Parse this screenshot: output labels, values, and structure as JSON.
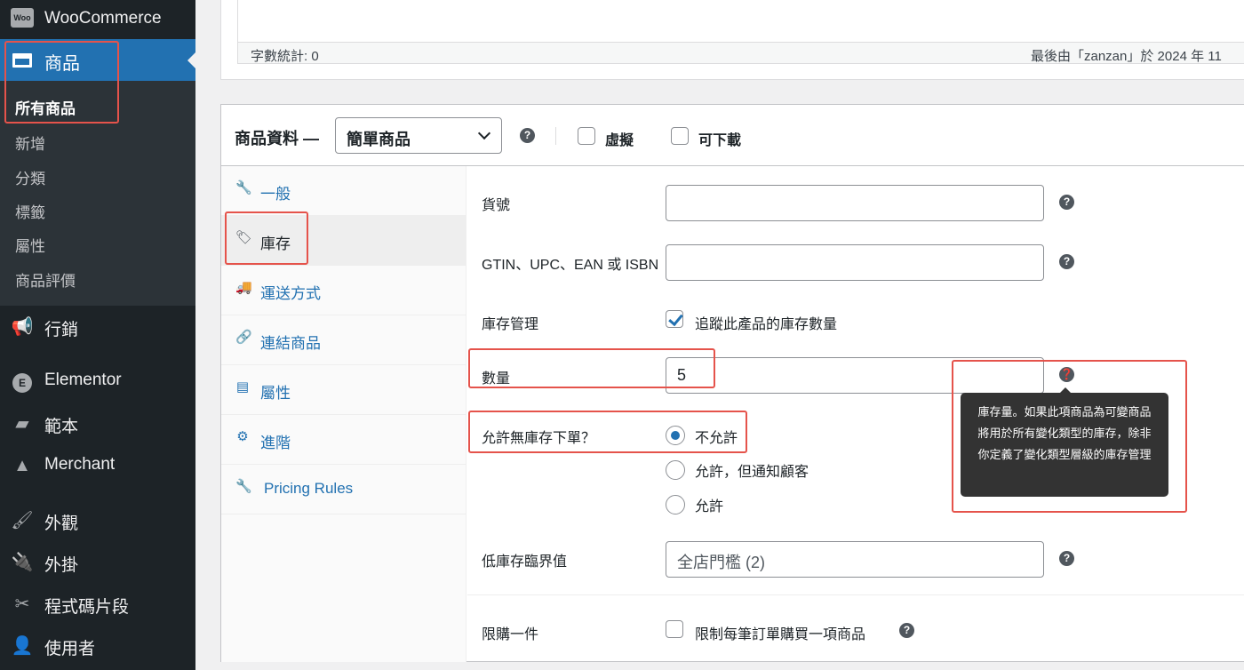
{
  "sidebar": {
    "brand_logo_text": "Woo",
    "brand": "WooCommerce",
    "active_menu": "商品",
    "submenu": [
      "所有商品",
      "新增",
      "分類",
      "標籤",
      "屬性",
      "商品評價"
    ],
    "menu": [
      "行銷",
      "Elementor",
      "範本",
      "Merchant",
      "外觀",
      "外掛",
      "程式碼片段",
      "使用者"
    ]
  },
  "editor": {
    "word_count": "字數統計: 0",
    "last_edit": "最後由「zanzan」於 2024 年 11"
  },
  "product_data": {
    "title": "商品資料 —",
    "type_value": "簡單商品",
    "virtual_label": "虛擬",
    "downloadable_label": "可下載",
    "tabs": [
      "一般",
      "庫存",
      "運送方式",
      "連結商品",
      "屬性",
      "進階",
      "Pricing Rules"
    ],
    "active_tab": "庫存",
    "fields": {
      "sku_label": "貨號",
      "sku_value": "",
      "gtin_label": "GTIN、UPC、EAN 或 ISBN",
      "gtin_value": "",
      "manage_stock_label": "庫存管理",
      "manage_stock_checkbox": "追蹤此產品的庫存數量",
      "manage_stock_checked": true,
      "quantity_label": "數量",
      "quantity_value": "5",
      "backorders_label": "允許無庫存下單？",
      "backorder_options": [
        "不允許",
        "允許，但通知顧客",
        "允許"
      ],
      "backorder_selected": "不允許",
      "low_stock_label": "低庫存臨界值",
      "low_stock_placeholder": "全店門檻 (2)",
      "sold_individually_label": "限購一件",
      "sold_individually_checkbox": "限制每筆訂單購買一項商品"
    },
    "tooltip": "庫存量。如果此項商品為可變商品將用於所有變化類型的庫存，除非你定義了變化類型層級的庫存管理"
  },
  "icons": {
    "help_glyph": "?",
    "help_glyph_hovered": "❓"
  },
  "colors": {
    "sidebar_bg": "#1d2327",
    "submenu_bg": "#2c3338",
    "active_blue": "#2271b1",
    "highlight_red": "#e5534b",
    "tooltip_bg": "#333333"
  }
}
